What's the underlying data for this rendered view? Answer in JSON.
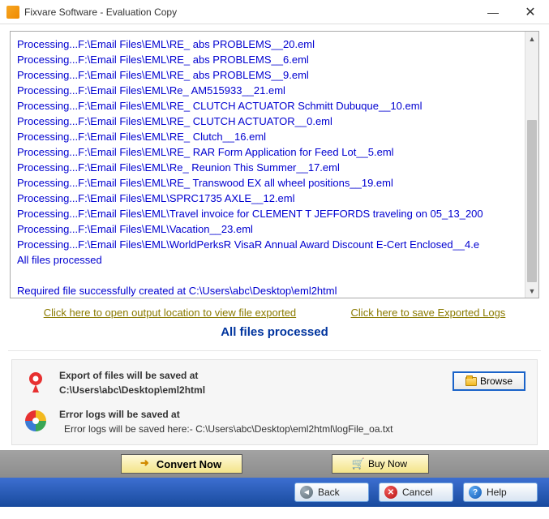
{
  "window": {
    "title": "Fixvare Software - Evaluation Copy"
  },
  "log": {
    "lines": [
      "Processing...F:\\Email Files\\EML\\RE_ abs PROBLEMS__20.eml",
      "Processing...F:\\Email Files\\EML\\RE_ abs PROBLEMS__6.eml",
      "Processing...F:\\Email Files\\EML\\RE_ abs PROBLEMS__9.eml",
      "Processing...F:\\Email Files\\EML\\Re_ AM515933__21.eml",
      "Processing...F:\\Email Files\\EML\\RE_ CLUTCH ACTUATOR Schmitt Dubuque__10.eml",
      "Processing...F:\\Email Files\\EML\\RE_ CLUTCH ACTUATOR__0.eml",
      "Processing...F:\\Email Files\\EML\\RE_ Clutch__16.eml",
      "Processing...F:\\Email Files\\EML\\RE_ RAR Form Application for Feed Lot__5.eml",
      "Processing...F:\\Email Files\\EML\\Re_ Reunion This Summer__17.eml",
      "Processing...F:\\Email Files\\EML\\RE_ Transwood EX all wheel positions__19.eml",
      "Processing...F:\\Email Files\\EML\\SPRC1735 AXLE__12.eml",
      "Processing...F:\\Email Files\\EML\\Travel invoice for CLEMENT T JEFFORDS traveling on 05_13_200",
      "Processing...F:\\Email Files\\EML\\Vacation__23.eml",
      "Processing...F:\\Email Files\\EML\\WorldPerksR VisaR Annual Award Discount E-Cert Enclosed__4.e",
      "All files processed",
      "",
      "Required file successfully created at C:\\Users\\abc\\Desktop\\eml2html"
    ]
  },
  "links": {
    "open_output": "Click here to open output location to view file exported",
    "save_logs": "Click here to save Exported Logs"
  },
  "status": "All files processed",
  "export": {
    "header": "Export of files will be saved at",
    "path": "C:\\Users\\abc\\Desktop\\eml2html",
    "browse_label": "Browse"
  },
  "errorlog": {
    "header": "Error logs will be saved at",
    "path": "Error logs will be saved here:- C:\\Users\\abc\\Desktop\\eml2html\\logFile_oa.txt"
  },
  "actions": {
    "convert": "Convert Now",
    "buy": "Buy Now"
  },
  "footer": {
    "back": "Back",
    "cancel": "Cancel",
    "help": "Help"
  }
}
